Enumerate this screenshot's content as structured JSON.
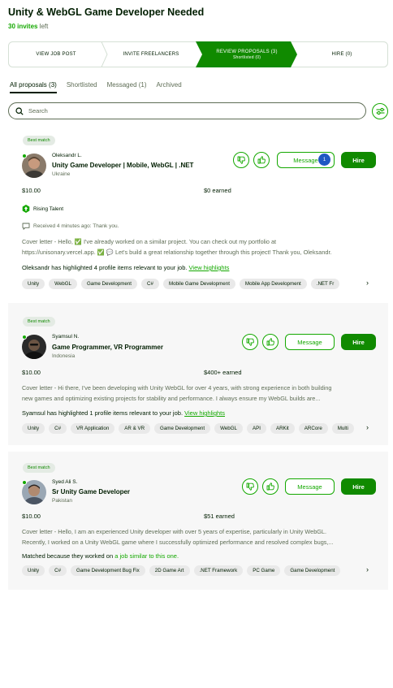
{
  "job": {
    "title": "Unity & WebGL Game Developer Needed",
    "invites_count": "30 invites",
    "invites_rest": " left"
  },
  "steps": [
    {
      "label": "VIEW JOB POST",
      "sub": ""
    },
    {
      "label": "INVITE FREELANCERS",
      "sub": ""
    },
    {
      "label": "REVIEW PROPOSALS (3)",
      "sub": "Shortlisted (0)"
    },
    {
      "label": "HIRE (0)",
      "sub": ""
    }
  ],
  "tabs": [
    "All proposals (3)",
    "Shortlisted",
    "Messaged (1)",
    "Archived"
  ],
  "search": {
    "placeholder": "Search"
  },
  "colors": {
    "accent": "#14a800",
    "hire": "#108a00",
    "badge_bg": "#e4ebe4",
    "message_count": "#1f57c3"
  },
  "proposals": [
    {
      "badge": "Best match",
      "name": "Oleksandr L.",
      "headline": "Unity Game Developer | Mobile, WebGL | .NET",
      "location": "Ukraine",
      "message_label": "Message",
      "message_count": "1",
      "hire_label": "Hire",
      "rate": "$10.00",
      "earned": "$0 earned",
      "rising_talent": "Rising Talent",
      "received": "Received 4 minutes ago: Thank you.",
      "cover_line1": "Cover letter - Hello, ✅ I've already worked on a similar project. You can check out my portfolio at",
      "cover_line2": "https://unisonary.vercel.app. ✅ 💬 Let's build a great relationship together through this project! Thank you, Oleksandr.",
      "highlight_text": "Oleksandr has highlighted 4 profile items relevant to your job. ",
      "highlight_link": "View highlights",
      "skills": [
        "Unity",
        "WebGL",
        "Game Development",
        "C#",
        "Mobile Game Development",
        "Mobile App Development",
        ".NET Fr"
      ]
    },
    {
      "badge": "Best match",
      "name": "Syamsul N.",
      "headline": "Game Programmer, VR Programmer",
      "location": "Indonesia",
      "message_label": "Message",
      "hire_label": "Hire",
      "rate": "$10.00",
      "earned": "$400+ earned",
      "cover_line1": "Cover letter - Hi there, I've been developing with Unity WebGL for over 4 years, with strong experience in both building",
      "cover_line2": "new games and optimizing existing projects for stability and performance. I always ensure my WebGL builds are...",
      "highlight_text": "Syamsul has highlighted 1 profile items relevant to your job. ",
      "highlight_link": "View highlights",
      "skills": [
        "Unity",
        "C#",
        "VR Application",
        "AR & VR",
        "Game Development",
        "WebGL",
        "API",
        "ARKit",
        "ARCore",
        "Multi"
      ]
    },
    {
      "badge": "Best match",
      "name": "Syed Ali S.",
      "headline": "Sr Unity Game Developer",
      "location": "Pakistan",
      "message_label": "Message",
      "hire_label": "Hire",
      "rate": "$10.00",
      "earned": "$51 earned",
      "cover_line1": "Cover letter - Hello, I am an experienced Unity developer with over 5 years of expertise, particularly in Unity WebGL.",
      "cover_line2": "Recently, I worked on a Unity WebGL game where I successfully optimized performance and resolved complex bugs,...",
      "highlight_text": "Matched because they worked on ",
      "highlight_link": "a job similar to this one.",
      "skills": [
        "Unity",
        "C#",
        "Game Development Bug Fix",
        "2D Game Art",
        ".NET Framework",
        "PC Game",
        "Game Development"
      ]
    }
  ]
}
